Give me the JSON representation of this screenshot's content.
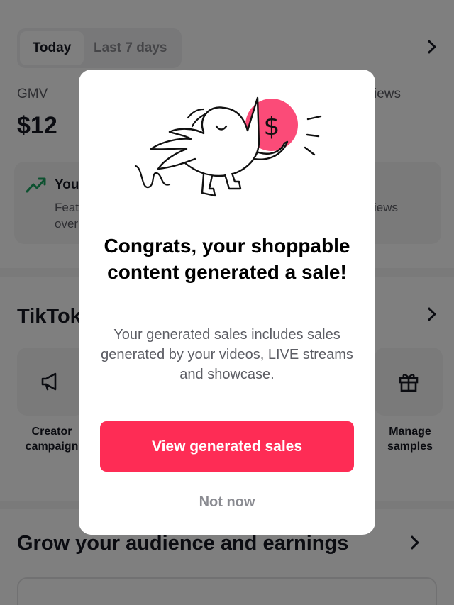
{
  "background": {
    "range_tabs": [
      "Today",
      "Last 7 days"
    ],
    "metrics": {
      "gmv_label": "GMV",
      "gmv_value": "$12",
      "views_label": "iews"
    },
    "insight": {
      "title": "You",
      "line1": "Feat",
      "line2": "over",
      "line_right": "iews",
      "icon": "trending-up-icon"
    },
    "tiktok_section": {
      "title": "TikTok",
      "tools": [
        {
          "label_line1": "Creator",
          "label_line2": "campaign",
          "icon": "megaphone-icon"
        },
        {
          "label_line1": "Manage",
          "label_line2": "samples",
          "icon": "gift-icon"
        }
      ]
    },
    "grow_section": {
      "title": "Grow your audience and earnings"
    }
  },
  "modal": {
    "illustration": "bird-with-money-bag",
    "title": "Congrats, your shoppable content generated a sale!",
    "body": "Your generated sales includes sales generated by your videos, LIVE streams and showcase.",
    "primary_button": "View generated sales",
    "secondary_button": "Not now"
  },
  "colors": {
    "accent": "#fe2c55",
    "overlay": "rgba(0,0,0,0.5)",
    "trend_green": "#1aa260"
  }
}
